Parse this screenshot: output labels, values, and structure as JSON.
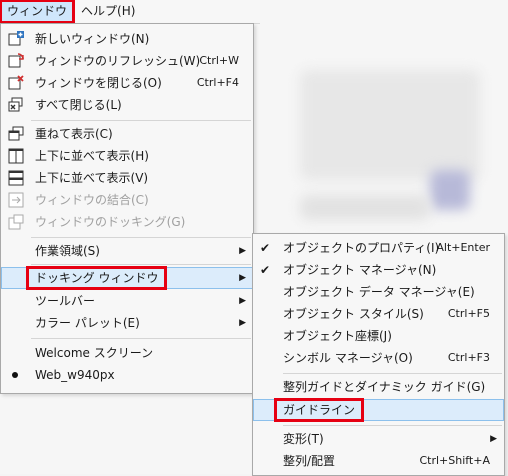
{
  "menubar": {
    "window": "ウィンドウ",
    "help": "ヘルプ(H)"
  },
  "window_menu": {
    "new_window": "新しいウィンドウ(N)",
    "refresh_window": "ウィンドウのリフレッシュ(W)",
    "refresh_shortcut": "Ctrl+W",
    "close_window": "ウィンドウを閉じる(O)",
    "close_shortcut": "Ctrl+F4",
    "close_all": "すべて閉じる(L)",
    "cascade": "重ねて表示(C)",
    "tile_h": "上下に並べて表示(H)",
    "tile_v": "上下に並べて表示(V)",
    "combine": "ウィンドウの結合(C)",
    "docking": "ウィンドウのドッキング(G)",
    "workspace": "作業領域(S)",
    "dockers": "ドッキング ウィンドウ",
    "toolbars": "ツールバー",
    "color_palettes": "カラー パレット(E)",
    "welcome": "Welcome スクリーン",
    "doc": "Web_w940px"
  },
  "docker_submenu": {
    "object_props": "オブジェクトのプロパティ(I)",
    "object_props_shortcut": "Alt+Enter",
    "object_manager": "オブジェクト マネージャ(N)",
    "object_data": "オブジェクト データ マネージャ(E)",
    "object_styles": "オブジェクト スタイル(S)",
    "object_styles_shortcut": "Ctrl+F5",
    "object_coords": "オブジェクト座標(J)",
    "symbol_manager": "シンボル マネージャ(O)",
    "symbol_shortcut": "Ctrl+F3",
    "align_guides": "整列ガイドとダイナミック ガイド(G)",
    "guidelines": "ガイドライン",
    "transform": "変形(T)",
    "align_distribute": "整列/配置",
    "align_shortcut": "Ctrl+Shift+A"
  },
  "colors": {
    "highlight_red": "#e60012",
    "selection": "#dcecfb"
  }
}
